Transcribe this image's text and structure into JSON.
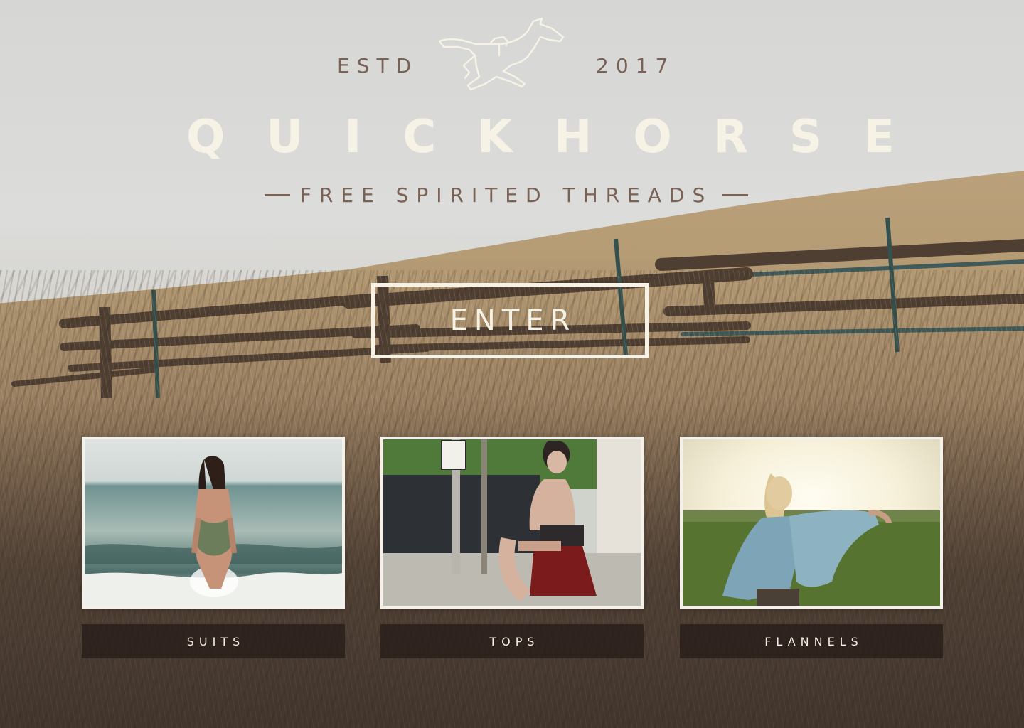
{
  "header": {
    "estd": "ESTD",
    "year": "2017",
    "logo_icon": "running-horse-icon",
    "brand": "QUICKHORSE",
    "tagline": "FREE SPIRITED THREADS"
  },
  "hero": {
    "enter_label": "ENTER"
  },
  "categories": [
    {
      "label": "SUITS",
      "photo": "woman-in-swimsuit-in-ocean-waves"
    },
    {
      "label": "TOPS",
      "photo": "tattooed-woman-sitting-on-city-street"
    },
    {
      "label": "FLANNELS",
      "photo": "woman-in-blue-shirt-in-sunlit-field"
    }
  ],
  "colors": {
    "cream": "#f6f2e6",
    "muted_brown": "#7a6256",
    "label_bar": "#261c18"
  }
}
